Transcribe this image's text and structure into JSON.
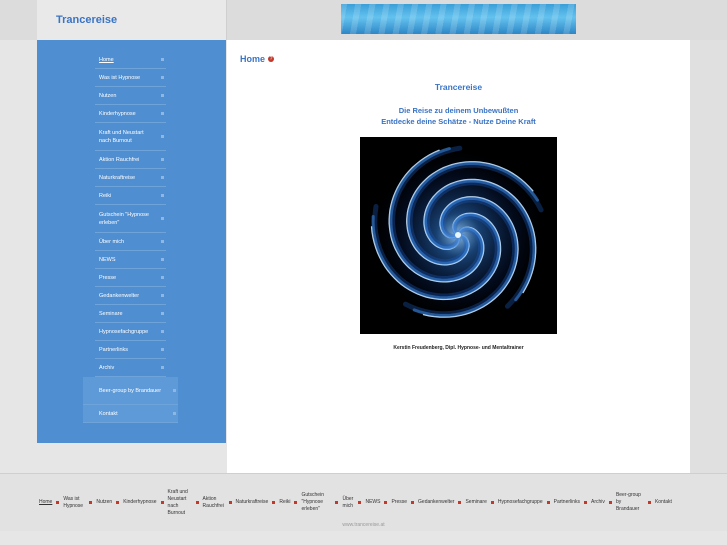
{
  "header": {
    "site_title": "Trancereise"
  },
  "sidebar": {
    "items": [
      {
        "label": "Home",
        "active": true
      },
      {
        "label": "Was ist Hypnose"
      },
      {
        "label": "Nutzen"
      },
      {
        "label": "Kinderhypnose"
      },
      {
        "label": "Kraft und Neustart nach Burnout"
      },
      {
        "label": "Aktion Rauchfrei"
      },
      {
        "label": "Naturkraftreise"
      },
      {
        "label": "Reiki"
      },
      {
        "label": "Gutschein \"Hypnose erleben\""
      },
      {
        "label": "Über mich"
      },
      {
        "label": "NEWS"
      },
      {
        "label": "Presse"
      },
      {
        "label": "Gedankenwelter"
      },
      {
        "label": "Seminare"
      },
      {
        "label": "Hypnosefachgruppe"
      },
      {
        "label": "Partnerlinks"
      },
      {
        "label": "Archiv"
      },
      {
        "label": "Beer-group by Brandauer"
      },
      {
        "label": "Kontakt"
      }
    ]
  },
  "main": {
    "page_title": "Home",
    "heading": "Trancereise",
    "subheading_1": "Die Reise zu deinem Unbewußten",
    "subheading_2": "Entdecke deine Schätze - Nutze Deine Kraft",
    "caption": "Kerstin Freudenberg, Dipl. Hypnose- und Mentaltrainer"
  },
  "footer": {
    "items": [
      "Home",
      "Was ist Hypnose",
      "Nutzen",
      "Kinderhypnose",
      "Kraft und Neustart nach Burnout",
      "Aktion Rauchfrei",
      "Naturkraftreise",
      "Reiki",
      "Gutschein \"Hypnose erleben\"",
      "Über mich",
      "NEWS",
      "Presse",
      "Gedankenwelter",
      "Seminare",
      "Hypnosefachgruppe",
      "Partnerlinks",
      "Archiv",
      "Beer-group by Brandauer",
      "Kontakt"
    ],
    "copyright": "www.trancereise.at"
  },
  "colors": {
    "accent": "#3a74c4",
    "sidebar": "#4f8ed1",
    "bullet": "#c0392b"
  }
}
